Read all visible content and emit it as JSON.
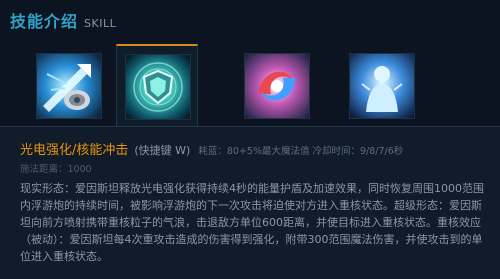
{
  "header": {
    "title": "技能介绍",
    "subtitle": "SKILL"
  },
  "skills": [
    {
      "icon": "shield-arrow-skill-icon",
      "active": false
    },
    {
      "icon": "shield-emblem-skill-icon",
      "active": true
    },
    {
      "icon": "energy-swirl-skill-icon",
      "active": false
    },
    {
      "icon": "glowing-figure-skill-icon",
      "active": false
    }
  ],
  "colors": {
    "accent": "#2fa3c6",
    "skill_name": "#e8930d",
    "active_tab": "#d98a18"
  },
  "detail": {
    "name": "光电强化/核能冲击",
    "hotkey": "(快捷键 W)",
    "stats": "耗蓝：80+5%最大魔法值 冷却时间：9/8/7/6秒",
    "range": "施法距离：1000",
    "description": "现实形态：爱因斯坦释放光电强化获得持续4秒的能量护盾及加速效果，同时恢复周围1000范围内浮游炮的持续时间，被影响浮游炮的下一次攻击将迫使对方进入重核状态。超级形态：爱因斯坦向前方喷射携带重核粒子的气浪，击退敌方单位600距离，并使目标进入重核状态。重核效应（被动）：爱因斯坦每4次重攻击造成的伤害得到强化，附带300范围魔法伤害，并使攻击到的单位进入重核状态。"
  }
}
